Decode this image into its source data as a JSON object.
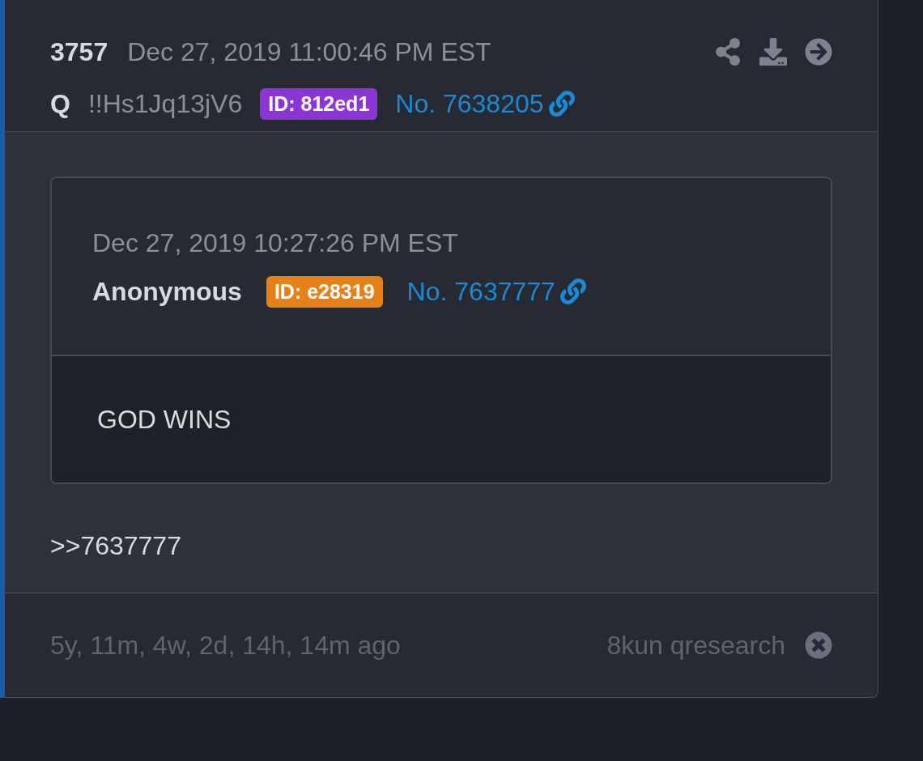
{
  "post": {
    "number": "3757",
    "date": "Dec 27, 2019 11:00:46 PM EST",
    "author": "Q",
    "tripcode": "!!Hs1Jq13jV6",
    "id_badge": {
      "text": "ID: 812ed1",
      "color": "#8a35d4"
    },
    "post_link": "No. 7638205"
  },
  "quote": {
    "date": "Dec 27, 2019 10:27:26 PM EST",
    "author": "Anonymous",
    "id_badge": {
      "text": "ID: e28319",
      "color": "#e6811a"
    },
    "post_link": "No. 7637777",
    "text": "GOD WINS"
  },
  "reply_text": ">>7637777",
  "footer": {
    "age": "5y, 11m, 4w, 2d, 14h, 14m ago",
    "source": "8kun qresearch"
  }
}
